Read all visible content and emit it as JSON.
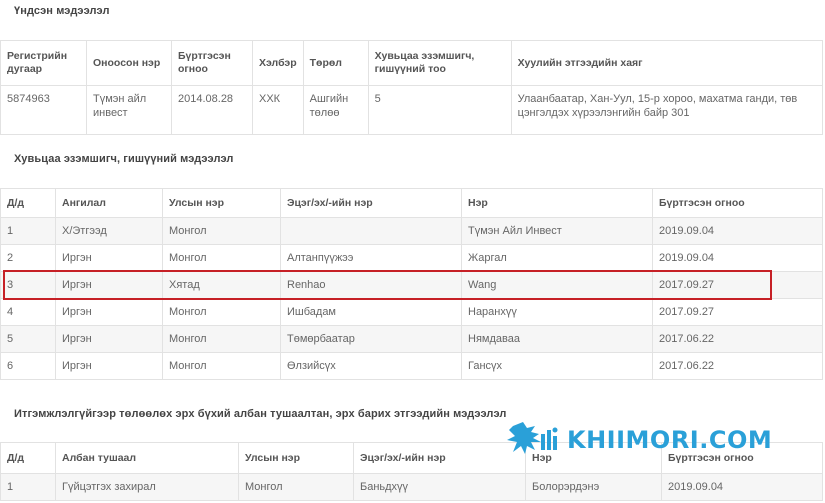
{
  "section1": {
    "title": "Үндсэн мэдээлэл",
    "headers": [
      "Регистрийн дугаар",
      "Оноосон нэр",
      "Бүртгэсэн огноо",
      "Хэлбэр",
      "Төрөл",
      "Хувьцаа эзэмшигч, гишүүний тоо",
      "Хуулийн этгээдийн хаяг"
    ],
    "row": [
      "5874963",
      "Түмэн айл инвест",
      "2014.08.28",
      "ХХК",
      "Ашгийн төлөө",
      "5",
      "Улаанбаатар, Хан-Уул, 15-р хороо, махатма ганди, төв цэнгэлдэх хүрээлэнгийн байр 301"
    ]
  },
  "section2": {
    "title": "Хувьцаа эзэмшигч, гишүүний мэдээлэл",
    "headers": [
      "Д/д",
      "Ангилал",
      "Улсын нэр",
      "Эцэг/эх/-ийн нэр",
      "Нэр",
      "Бүртгэсэн огноо"
    ],
    "rows": [
      [
        "1",
        "Х/Этгээд",
        "Монгол",
        "",
        "Түмэн Айл Инвест",
        "2019.09.04"
      ],
      [
        "2",
        "Иргэн",
        "Монгол",
        "Алтанпүүжээ",
        "Жаргал",
        "2019.09.04"
      ],
      [
        "3",
        "Иргэн",
        "Хятад",
        "Renhao",
        "Wang",
        "2017.09.27"
      ],
      [
        "4",
        "Иргэн",
        "Монгол",
        "Ишбадам",
        "Наранхүү",
        "2017.09.27"
      ],
      [
        "5",
        "Иргэн",
        "Монгол",
        "Төмөрбаатар",
        "Нямдаваа",
        "2017.06.22"
      ],
      [
        "6",
        "Иргэн",
        "Монгол",
        "Өлзийсүх",
        "Гансүх",
        "2017.06.22"
      ]
    ],
    "highlight_color": "#c62026"
  },
  "section3": {
    "title": "Итгэмжлэлгүйгээр төлөөлөх эрх бүхий албан тушаалтан, эрх барих этгээдийн мэдээлэл",
    "headers": [
      "Д/д",
      "Албан тушаал",
      "Улсын нэр",
      "Эцэг/эх/-ийн нэр",
      "Нэр",
      "Бүртгэсэн огноо"
    ],
    "rows": [
      [
        "1",
        "Гүйцэтгэх захирал",
        "Монгол",
        "Баньдхүү",
        "Болорэрдэнэ",
        "2019.09.04"
      ]
    ]
  },
  "watermark": {
    "text": "KHIIMORI.COM",
    "icon": "horse-logo-icon",
    "color": "#2aa0d8"
  }
}
